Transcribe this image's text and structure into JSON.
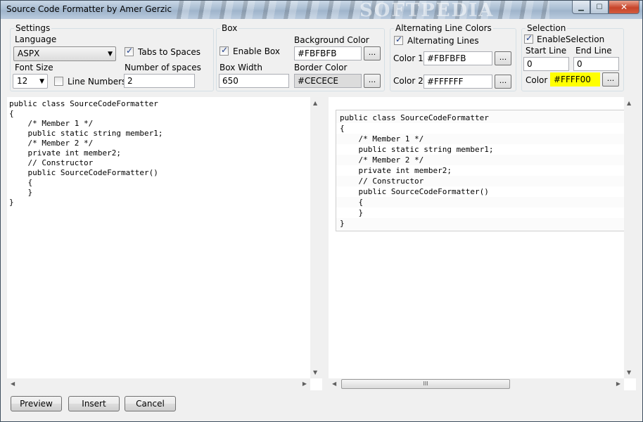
{
  "window": {
    "title": "Source Code Formatter by Amer Gerzic",
    "watermark": "SOFTPEDIA",
    "watermark_url": "www.softpedia.com"
  },
  "settings": {
    "group_title": "Settings",
    "language_label": "Language",
    "language_value": "ASPX",
    "tabs_to_spaces_label": "Tabs to Spaces",
    "tabs_to_spaces_checked": true,
    "font_size_label": "Font Size",
    "font_size_value": "12",
    "line_numbers_label": "Line Numbers",
    "line_numbers_checked": false,
    "number_of_spaces_label": "Number of spaces",
    "number_of_spaces_value": "2"
  },
  "box": {
    "group_title": "Box",
    "enable_box_label": "Enable Box",
    "enable_box_checked": true,
    "background_color_label": "Background Color",
    "background_color_value": "#FBFBFB",
    "box_width_label": "Box Width",
    "box_width_value": "650",
    "border_color_label": "Border Color",
    "border_color_value": "#CECECE",
    "browse_label": "..."
  },
  "alternating": {
    "group_title": "Alternating Line Colors",
    "alternating_lines_label": "Alternating Lines",
    "alternating_lines_checked": true,
    "color1_label": "Color 1",
    "color1_value": "#FBFBFB",
    "color2_label": "Color 2",
    "color2_value": "#FFFFFF",
    "browse_label": "..."
  },
  "selection": {
    "group_title": "Selection",
    "enable_selection_label": "EnableSelection",
    "enable_selection_checked": true,
    "start_line_label": "Start Line",
    "start_line_value": "0",
    "end_line_label": "End Line",
    "end_line_value": "0",
    "color_label": "Color",
    "color_value": "#FFFF00",
    "browse_label": "..."
  },
  "editor": {
    "lines": [
      "public class SourceCodeFormatter",
      "{",
      "    /* Member 1 */",
      "    public static string member1;",
      "    /* Member 2 */",
      "    private int member2;",
      "    // Constructor",
      "    public SourceCodeFormatter()",
      "    {",
      "    }",
      "}"
    ]
  },
  "preview_pane": {
    "lines": [
      "public class SourceCodeFormatter",
      "{",
      "    /* Member 1 */",
      "    public static string member1;",
      "    /* Member 2 */",
      "    private int member2;",
      "    // Constructor",
      "    public SourceCodeFormatter()",
      "    {",
      "    }",
      "}"
    ],
    "scroll_grip": "III"
  },
  "buttons": {
    "preview": "Preview",
    "insert": "Insert",
    "cancel": "Cancel"
  },
  "colors": {
    "box_background": "#FBFBFB",
    "box_border": "#CECECE",
    "alt_color1": "#FBFBFB",
    "alt_color2": "#FFFFFF",
    "selection": "#FFFF00"
  }
}
